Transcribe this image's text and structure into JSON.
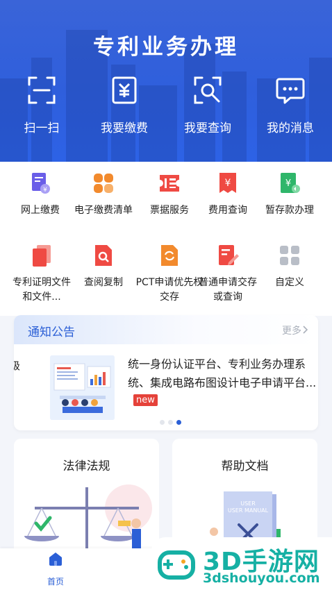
{
  "header": {
    "title": "专利业务办理",
    "quick_actions": [
      {
        "label": "扫一扫",
        "icon": "scan-icon"
      },
      {
        "label": "我要缴费",
        "icon": "payment-receipt-icon"
      },
      {
        "label": "我要查询",
        "icon": "search-query-icon"
      },
      {
        "label": "我的消息",
        "icon": "message-icon"
      }
    ]
  },
  "services": {
    "items": [
      {
        "label": "网上缴费",
        "icon": "online-payment-icon",
        "color": "#6a5ee8"
      },
      {
        "label": "电子缴费清单",
        "icon": "bill-list-icon",
        "color": "#f28a2d"
      },
      {
        "label": "票据服务",
        "icon": "invoice-icon",
        "color": "#ef4a43"
      },
      {
        "label": "费用查询",
        "icon": "fee-query-icon",
        "color": "#ef4a43"
      },
      {
        "label": "暂存款办理",
        "icon": "deposit-icon",
        "color": "#2fb66a"
      },
      {
        "label": "专利证明文件和文件...",
        "icon": "certificate-icon",
        "color": "#ef4a43"
      },
      {
        "label": "查阅复制",
        "icon": "document-search-icon",
        "color": "#ef4a43"
      },
      {
        "label": "PCT申请优先权交存",
        "icon": "pct-icon",
        "color": "#f28a2d"
      },
      {
        "label": "普通申请交存或查询",
        "icon": "edit-document-icon",
        "color": "#ef4a43"
      },
      {
        "label": "自定义",
        "icon": "grid-icon",
        "color": "#b9bec7"
      }
    ]
  },
  "notice": {
    "title": "通知公告",
    "more": "更多",
    "prev_fragment": "级",
    "text": "统一身份认证平台、专利业务办理系统、集成电路布图设计电子申请平台...",
    "badge": "new"
  },
  "cards": [
    {
      "title": "法律法规"
    },
    {
      "title": "帮助文档",
      "art_text": "USER MANUAL"
    }
  ],
  "tabbar": {
    "home": "首页"
  },
  "watermark": {
    "title": "3D手游网",
    "url": "3dshouyou.com"
  }
}
